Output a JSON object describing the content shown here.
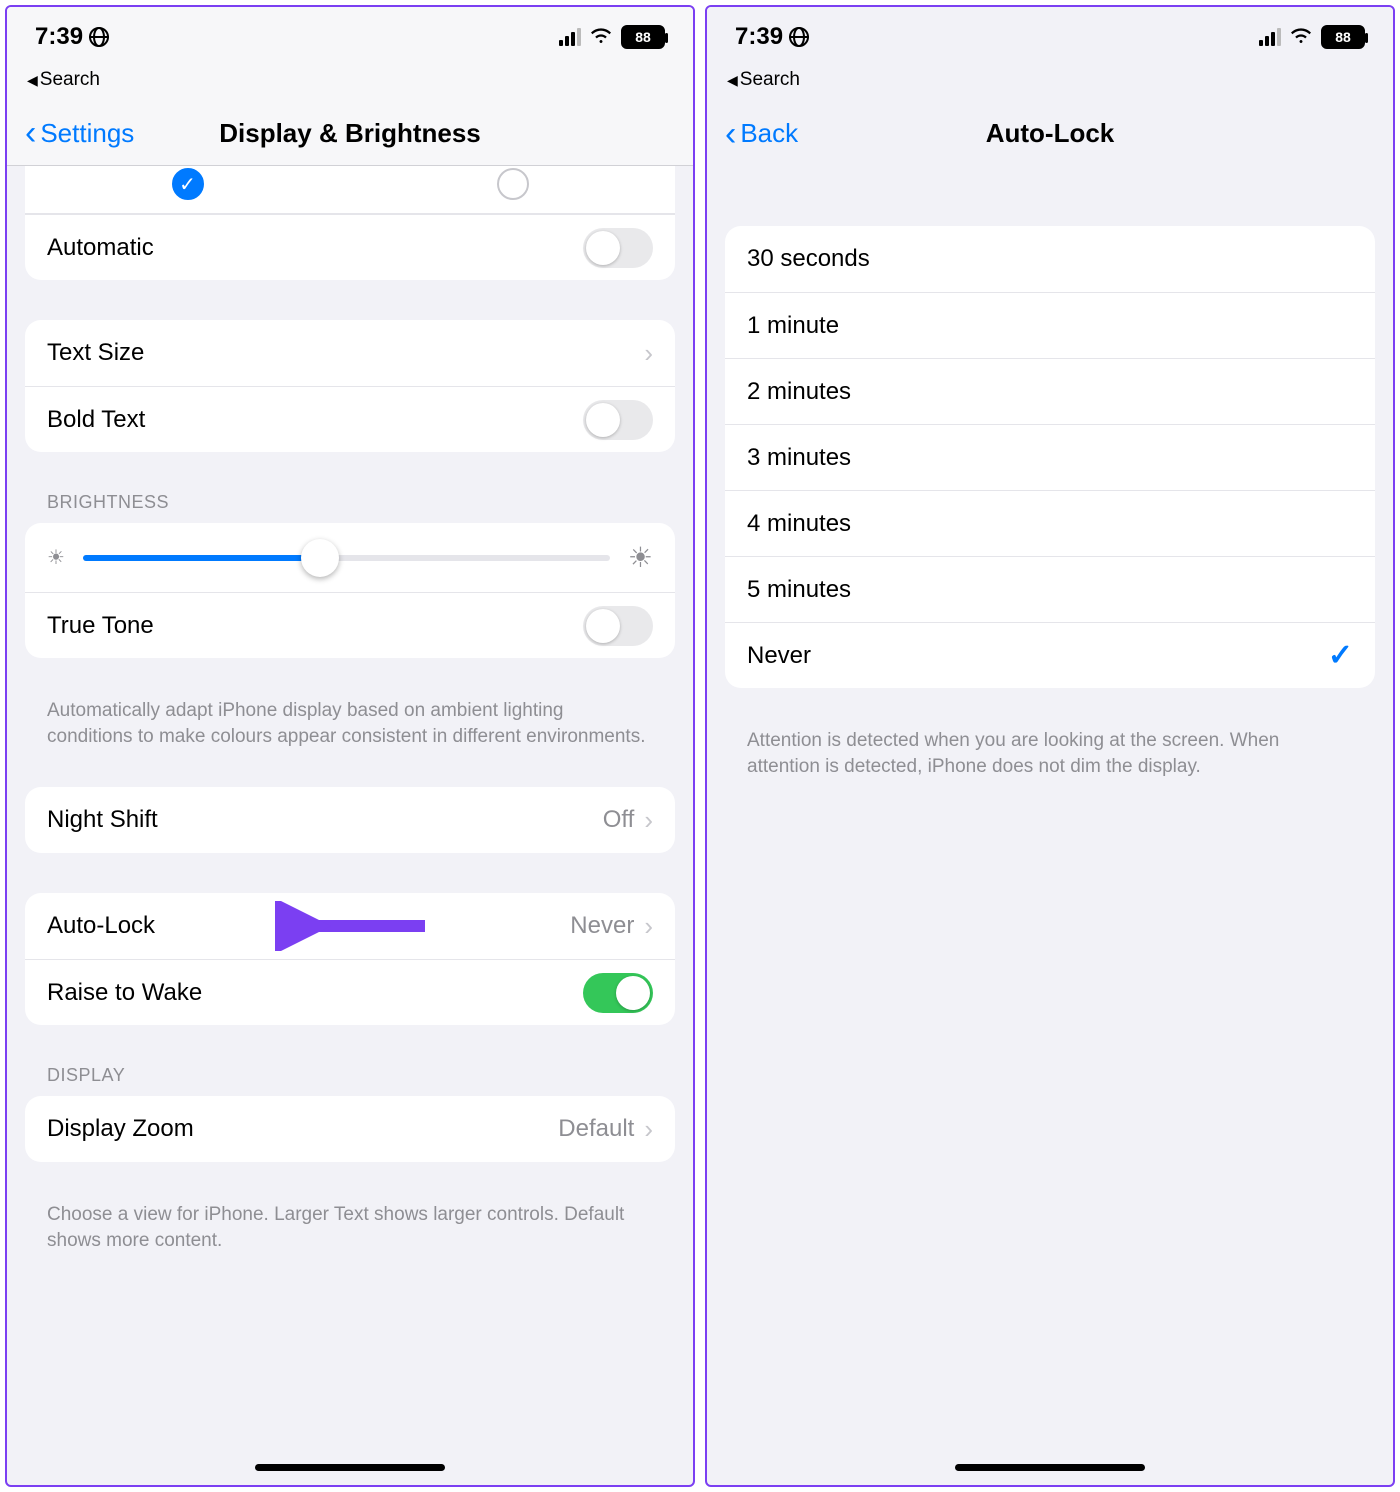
{
  "status": {
    "time": "7:39",
    "battery": "88"
  },
  "breadcrumb": "Search",
  "left": {
    "back": "Settings",
    "title": "Display & Brightness",
    "automatic": "Automatic",
    "text_size": "Text Size",
    "bold_text": "Bold Text",
    "brightness_header": "BRIGHTNESS",
    "true_tone": "True Tone",
    "true_tone_footer": "Automatically adapt iPhone display based on ambient lighting conditions to make colours appear consistent in different environments.",
    "night_shift": "Night Shift",
    "night_shift_value": "Off",
    "auto_lock": "Auto-Lock",
    "auto_lock_value": "Never",
    "raise_to_wake": "Raise to Wake",
    "display_header": "DISPLAY",
    "display_zoom": "Display Zoom",
    "display_zoom_value": "Default",
    "display_footer": "Choose a view for iPhone. Larger Text shows larger controls. Default shows more content.",
    "brightness_percent": 45
  },
  "right": {
    "back": "Back",
    "title": "Auto-Lock",
    "options": [
      "30 seconds",
      "1 minute",
      "2 minutes",
      "3 minutes",
      "4 minutes",
      "5 minutes",
      "Never"
    ],
    "selected": "Never",
    "footer": "Attention is detected when you are looking at the screen. When attention is detected, iPhone does not dim the display."
  }
}
